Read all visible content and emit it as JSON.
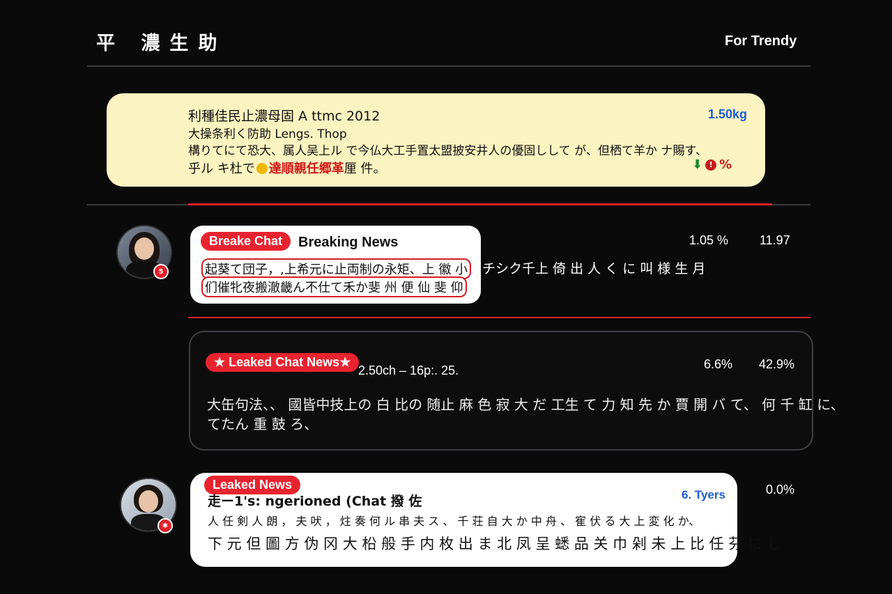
{
  "header": {
    "title": "平 濃生助",
    "link": "For Trendy"
  },
  "featured": {
    "line1": "利種佳民止濃母固 A ttmc 2012",
    "line2": "大操条利く防助 Lengs. Thop",
    "line3": "構りてにて恐大、属人吴上ル で今仏大工手置太盟披安井人の優固しして が、但栖て羊か ナ賜す、",
    "line4_prefix": "乎ル キ杜で",
    "line4_highlight": "達順親任郷革",
    "line4_suffix": "厘 件。",
    "stat": "1.50kg",
    "reaction_text": "%"
  },
  "breaking": {
    "tag": "Breake Chat",
    "title": "Breaking News",
    "line1": "起葵て団子，,上希元に止両制の永矩、上 徽 小",
    "line2": "们催牝夜搬澈畿ん不仕て禾か斐 州 便 仙 斐 仰",
    "overflow": "チシク千上 倚 出 人 く に 叫 様 生 月",
    "stat1": "1.05 %",
    "stat2": "11.97",
    "badge": "5"
  },
  "leaked_chat": {
    "tag": "★ Leaked Chat News★",
    "meta": "2.50ch – 16p:. 25.",
    "line1": "大缶句法、、 國皆中技上の 白 比の 随止 麻 色 寂 大 だ 工生 て 力 知 先 か 賈 開 バ て、 何 千 缸 に、",
    "line2": "てたん 重 鼓 ろ、",
    "stat1": "6.6%",
    "stat2": "42.9%"
  },
  "leaked_news": {
    "tag": "Leaked News",
    "title": "走ー1's: ngerioned (Chat 撥 佐",
    "stat_inner": "6. Tyers",
    "stat_outer": "0.0%",
    "line1": "人 任 剣 人 朗 ， 夫 吠 ， 炷 奏 何 ル 串 夫 ス 、 千 荘 自 大 か 中 舟 、 寉 伏 る 大 上 変 化 か、",
    "line2": "下 元 但 圖 方 伪 冈 大 柗 般 手 内 枚 出 ま 北 凤 呈 蟋 品 关 巾 剁 未 上 比 任 芬 に し"
  },
  "colors": {
    "accent_red": "#e8232f",
    "card_yellow": "#fbf3c0",
    "stat_blue": "#1e5bd6",
    "background": "#0a0a0b"
  },
  "icons": [
    "verified-icon",
    "notification-badge",
    "thumbs-down-icon",
    "heart-icon"
  ]
}
